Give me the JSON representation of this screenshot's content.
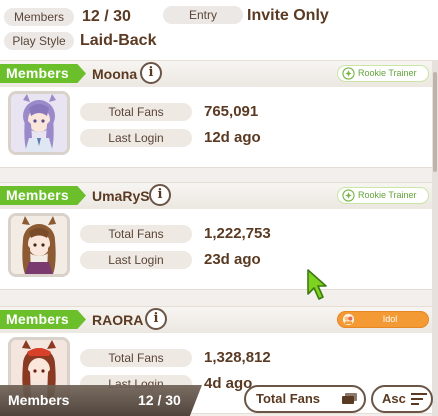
{
  "club": {
    "members_label": "Members",
    "members_value": "12 / 30",
    "entry_label": "Entry",
    "entry_value": "Invite Only",
    "playstyle_label": "Play Style",
    "playstyle_value": "Laid-Back"
  },
  "members": [
    {
      "tag": "Members",
      "name": "Moona",
      "badge": "Rookie Trainer",
      "badge_type": "rookie",
      "fans_label": "Total Fans",
      "fans": "765,091",
      "login_label": "Last Login",
      "login": "12d ago",
      "avatar_hair": "#9a8ac9",
      "avatar_bg": "#e8e4f2"
    },
    {
      "tag": "Members",
      "name": "UmaRyS",
      "badge": "Rookie Trainer",
      "badge_type": "rookie",
      "fans_label": "Total Fans",
      "fans": "1,222,753",
      "login_label": "Last Login",
      "login": "23d ago",
      "avatar_hair": "#8c5a33",
      "avatar_bg": "#f2ece4"
    },
    {
      "tag": "Members",
      "name": "RAORA",
      "badge": "Idol",
      "badge_type": "idol",
      "fans_label": "Total Fans",
      "fans": "1,328,812",
      "login_label": "Last Login",
      "login": "4d ago",
      "avatar_hair": "#8a3a22",
      "avatar_bg": "#f4e6de"
    }
  ],
  "footer": {
    "label": "Members",
    "count": "12 / 30",
    "sort_label": "Total Fans",
    "order_label": "Asc"
  },
  "colors": {
    "tag_green": "#6bbf2a",
    "text_brown": "#5a3a22",
    "idol_orange": "#f39a34"
  }
}
